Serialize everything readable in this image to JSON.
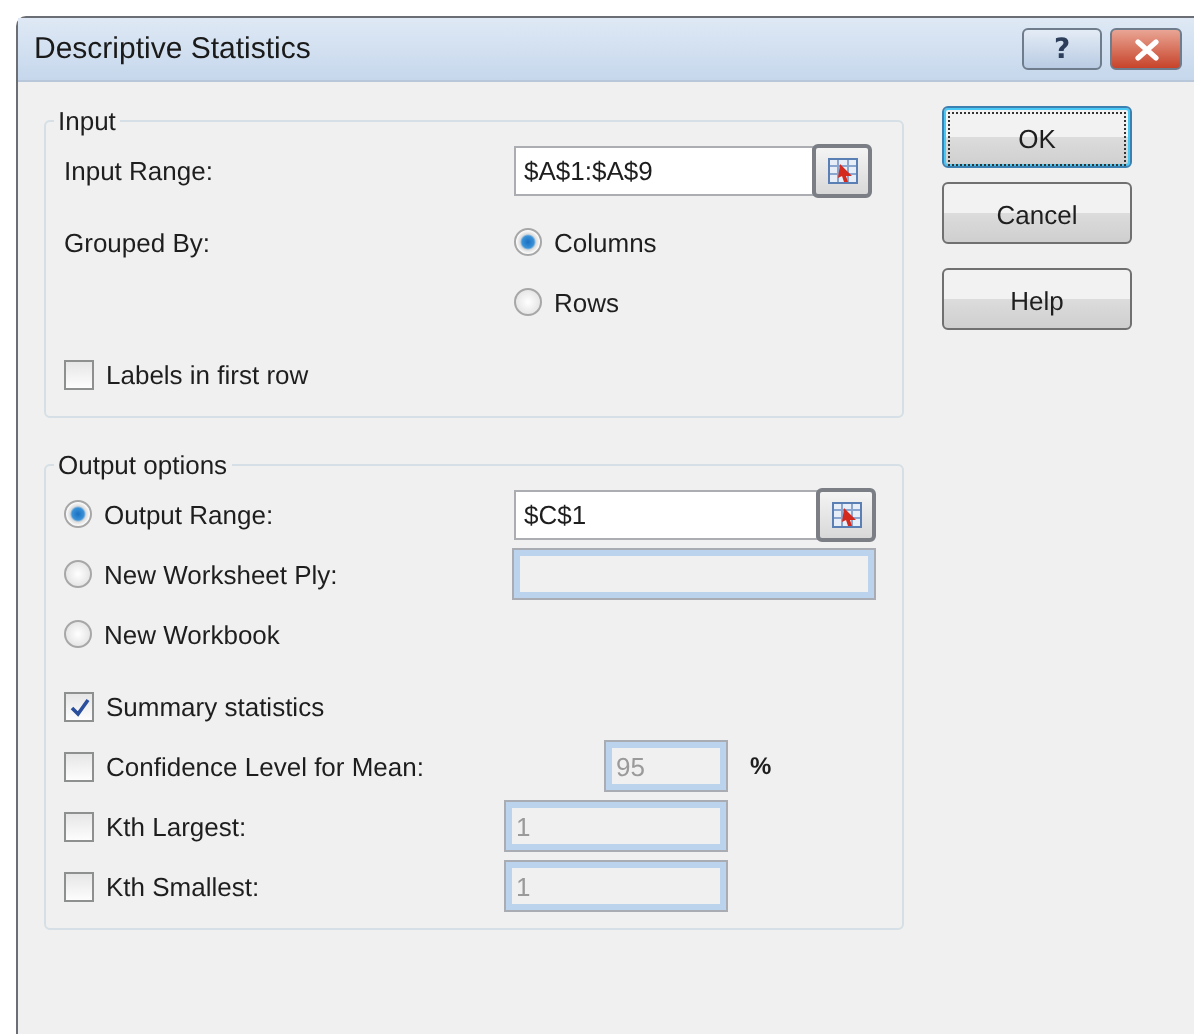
{
  "window": {
    "title": "Descriptive Statistics",
    "help_button": "?"
  },
  "input": {
    "legend": "Input",
    "rows": [
      {
        "kind": "field",
        "label": "Input Range:",
        "field": {
          "value": "$A$1:$A$9",
          "disabled": false,
          "picker": true
        }
      },
      {
        "kind": "radio",
        "label": "Grouped By:",
        "option": "Columns",
        "selected": true
      },
      {
        "kind": "radio",
        "option": "Rows",
        "selected": false
      },
      {
        "kind": "checkbox",
        "label": "Labels in first row",
        "checked": false
      }
    ]
  },
  "output": {
    "legend": "Output options",
    "rows": [
      {
        "kind": "radio",
        "option": "Output Range:",
        "selected": true,
        "field": {
          "value": "$C$1",
          "disabled": false,
          "picker": true
        }
      },
      {
        "kind": "radio",
        "option": "New Worksheet Ply:",
        "selected": false,
        "field": {
          "disabled": true
        }
      },
      {
        "kind": "radio",
        "option": "New Workbook",
        "selected": false
      },
      {
        "kind": "checkbox",
        "label": "Summary statistics",
        "checked": true
      },
      {
        "kind": "checkbox",
        "label": "Confidence Level for Mean:",
        "checked": false,
        "field": {
          "value": "95",
          "disabled": true
        },
        "suffix": "%"
      },
      {
        "kind": "checkbox",
        "label": "Kth Largest:",
        "checked": false,
        "field": {
          "value": "1",
          "disabled": true
        }
      },
      {
        "kind": "checkbox",
        "label": "Kth Smallest:",
        "checked": false,
        "field": {
          "value": "1",
          "disabled": true
        }
      }
    ]
  },
  "buttons": [
    {
      "label": "OK",
      "focused": true
    },
    {
      "label": "Cancel",
      "focused": false
    },
    {
      "label": "Help",
      "focused": false
    }
  ]
}
